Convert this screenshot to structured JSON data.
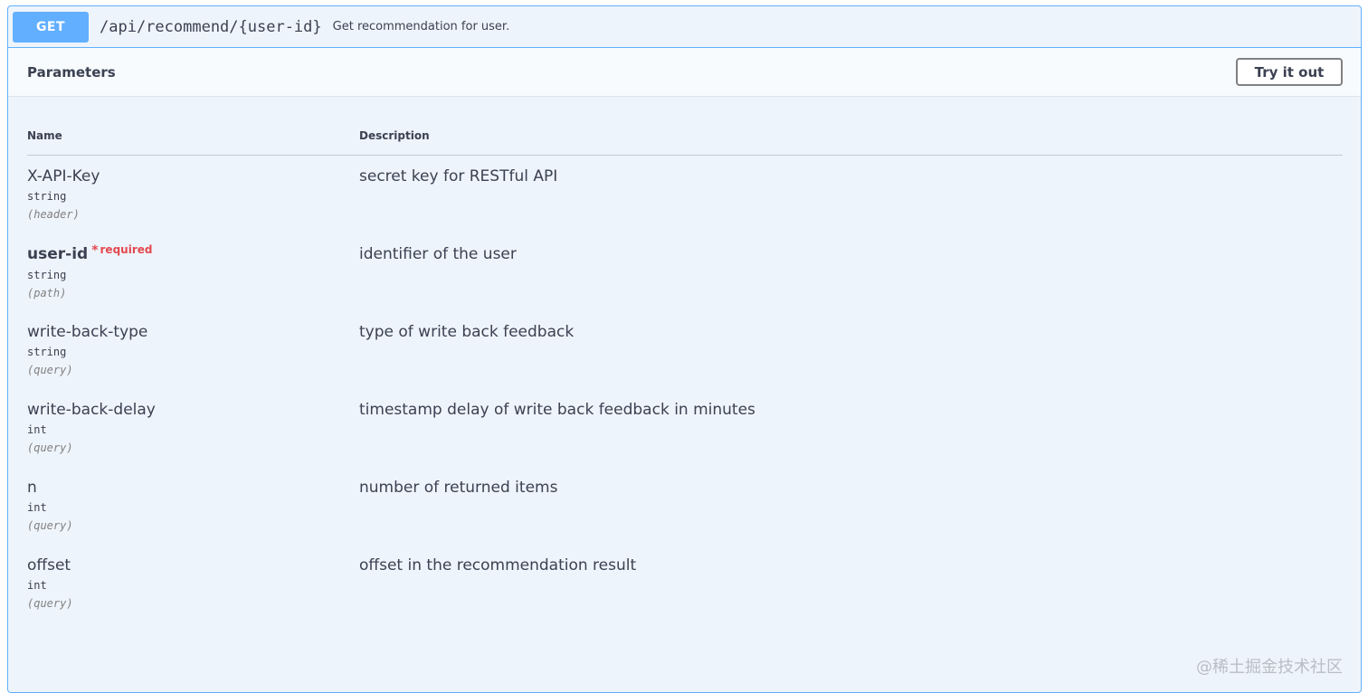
{
  "operation": {
    "method": "GET",
    "path": "/api/recommend/{user-id}",
    "summary": "Get recommendation for user."
  },
  "section": {
    "title": "Parameters",
    "try_button": "Try it out"
  },
  "table": {
    "headers": {
      "name": "Name",
      "description": "Description"
    },
    "required_star": "*",
    "required_label": "required",
    "rows": [
      {
        "name": "X-API-Key",
        "type": "string",
        "in": "(header)",
        "description": "secret key for RESTful API",
        "required": false
      },
      {
        "name": "user-id",
        "type": "string",
        "in": "(path)",
        "description": "identifier of the user",
        "required": true
      },
      {
        "name": "write-back-type",
        "type": "string",
        "in": "(query)",
        "description": "type of write back feedback",
        "required": false
      },
      {
        "name": "write-back-delay",
        "type": "int",
        "in": "(query)",
        "description": "timestamp delay of write back feedback in minutes",
        "required": false
      },
      {
        "name": "n",
        "type": "int",
        "in": "(query)",
        "description": "number of returned items",
        "required": false
      },
      {
        "name": "offset",
        "type": "int",
        "in": "(query)",
        "description": "offset in the recommendation result",
        "required": false
      }
    ]
  },
  "watermark": "@稀土掘金技术社区",
  "colors": {
    "method_bg": "#61affe",
    "block_bg": "#eef4fb",
    "required": "#e3494f"
  }
}
